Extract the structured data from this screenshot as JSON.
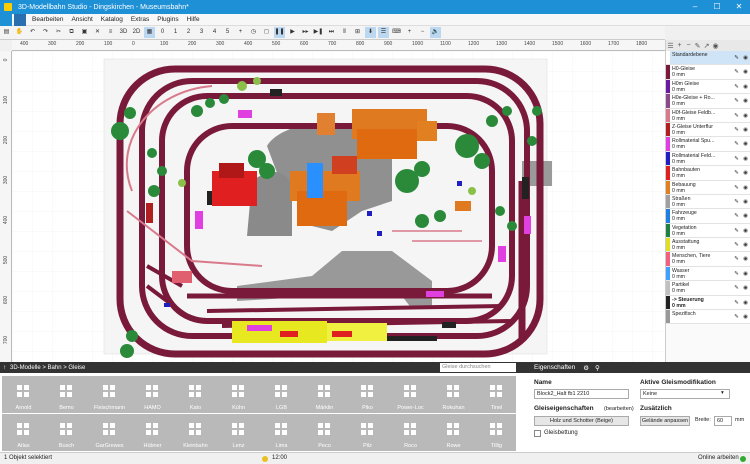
{
  "window": {
    "title": "3D-Modellbahn Studio - Dingskirchen - Museumsbahn*"
  },
  "menu": [
    "Bearbeiten",
    "Ansicht",
    "Katalog",
    "Extras",
    "Plugins",
    "Hilfe"
  ],
  "toolbar": {
    "b1": "3D",
    "b2": "2D",
    "n0": "0",
    "n1": "1",
    "n2": "2",
    "n3": "3",
    "n4": "4",
    "n5": "5"
  },
  "ruler": {
    "top": [
      "400",
      "300",
      "200",
      "100",
      "0",
      "100",
      "200",
      "300",
      "400",
      "500",
      "600",
      "700",
      "800",
      "900",
      "1000",
      "1100",
      "1200",
      "1300",
      "1400",
      "1500",
      "1600",
      "1700",
      "1800"
    ],
    "left": [
      "0",
      "100",
      "200",
      "300",
      "400",
      "500",
      "600",
      "700"
    ]
  },
  "layers": [
    {
      "name": "Standardebene",
      "sub": "",
      "color": "#ffffff",
      "sel": true
    },
    {
      "name": "H0-Gleise",
      "sub": "0 mm",
      "color": "#7a1a3a"
    },
    {
      "name": "H0m Gleise",
      "sub": "0 mm",
      "color": "#6a1aa0"
    },
    {
      "name": "H0e-Gleise + Ro...",
      "sub": "0 mm",
      "color": "#8a4a8a"
    },
    {
      "name": "H0f-Gleise Feldb...",
      "sub": "0 mm",
      "color": "#d87a8a"
    },
    {
      "name": "Z-Gleise Unterflur",
      "sub": "0 mm",
      "color": "#b02020"
    },
    {
      "name": "Rollmaterial Spu...",
      "sub": "0 mm",
      "color": "#e040e0"
    },
    {
      "name": "Rollmaterial Feld...",
      "sub": "0 mm",
      "color": "#2020c0"
    },
    {
      "name": "Bahnbauten",
      "sub": "0 mm",
      "color": "#e02020"
    },
    {
      "name": "Bebauung",
      "sub": "0 mm",
      "color": "#e08020"
    },
    {
      "name": "Straßen",
      "sub": "0 mm",
      "color": "#a0a0a0"
    },
    {
      "name": "Fahrzeuge",
      "sub": "0 mm",
      "color": "#2080e0"
    },
    {
      "name": "Vegetation",
      "sub": "0 mm",
      "color": "#208040"
    },
    {
      "name": "Ausstattung",
      "sub": "0 mm",
      "color": "#e0e020"
    },
    {
      "name": "Menschen, Tiere",
      "sub": "0 mm",
      "color": "#f06080"
    },
    {
      "name": "Wasser",
      "sub": "0 mm",
      "color": "#40a0ff"
    },
    {
      "name": "Partikel",
      "sub": "0 mm",
      "color": "#c0c0c0"
    },
    {
      "name": "-> Steuerung",
      "sub": "0 mm",
      "color": "#222222"
    },
    {
      "name": "Spezifisch",
      "sub": "",
      "color": "#999999"
    }
  ],
  "library": {
    "breadcrumb": "3D-Modelle  >  Bahn  >  Gleise",
    "search_placeholder": "Gleise durchsuchen",
    "row1": [
      "Arnold",
      "Bemo",
      "Fleischmann",
      "HAMO",
      "Kato",
      "Kühn",
      "LGB",
      "Märklin",
      "Piko",
      "Power-Loc",
      "Rokuhan",
      "Tinel"
    ],
    "row2": [
      "Atlas",
      "Busch",
      "GarGrewes",
      "Hübner",
      "Kleinbahn",
      "Lenz",
      "Lima",
      "Peco",
      "Pilz",
      "Roco",
      "Rowe",
      "Tillig"
    ]
  },
  "props": {
    "header": "Eigenschaften",
    "name_label": "Name",
    "name_value": "Block2_Halt fb1 2210",
    "gleis_label": "Gleiseigenschaften",
    "gleis_edit": "(bearbeiten)",
    "holz_button": "Holz und Schotter (Beige)",
    "gleisbett": "Gleisbettung",
    "mod_label": "Aktive Gleismodifikation",
    "mod_value": "Keine",
    "zus_label": "Zusätzlich",
    "gel_button": "Gelände anpassen",
    "breite_label": "Breite:",
    "breite_value": "60",
    "breite_unit": "mm"
  },
  "status": {
    "left": "1 Objekt selektiert",
    "time": "12:00",
    "right": "Online arbeiten"
  }
}
